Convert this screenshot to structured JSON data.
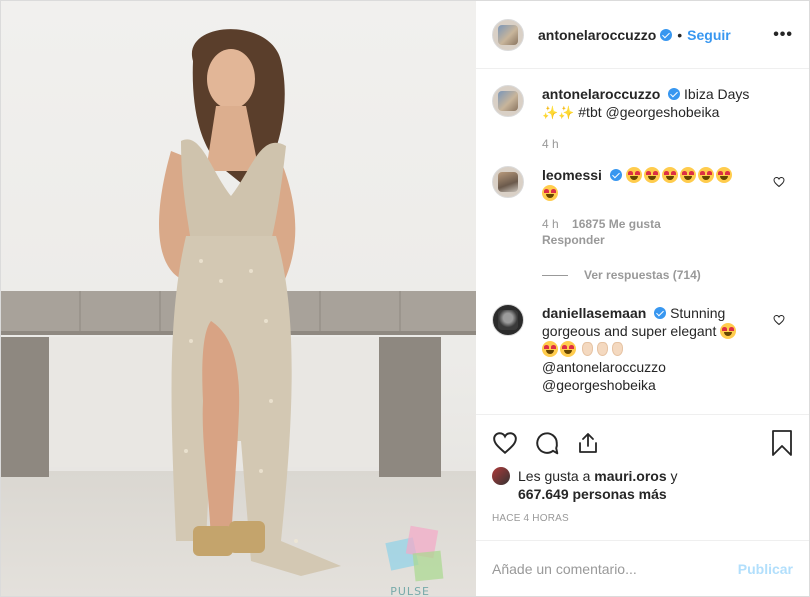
{
  "header": {
    "username": "antonelaroccuzzo",
    "separator": "•",
    "follow_label": "Seguir",
    "more_label": "•••"
  },
  "photo": {
    "watermark_text": "PULSE"
  },
  "caption": {
    "username": "antonelaroccuzzo",
    "text_line1": "Ibiza Days",
    "text_line2": "#tbt @georgeshobeika",
    "time": "4 h"
  },
  "comments": [
    {
      "username": "leomessi",
      "time": "4 h",
      "likes": "16875 Me gusta",
      "reply_label": "Responder",
      "view_replies": "Ver respuestas (714)"
    },
    {
      "username": "daniellasemaan",
      "text_line1": "Stunning",
      "text_line2": "gorgeous and super elegant",
      "mention1": "@antonelaroccuzzo",
      "mention2": "@georgeshobeika"
    }
  ],
  "actions": {
    "icons": [
      "heart-icon",
      "comment-icon",
      "share-icon",
      "bookmark-icon"
    ]
  },
  "likes": {
    "prefix": "Les gusta a",
    "user": "mauri.oros",
    "conj": "y",
    "count": "667.649 personas más"
  },
  "timestamp": "HACE 4 HORAS",
  "add_comment": {
    "placeholder": "Añade un comentario...",
    "publish_label": "Publicar"
  },
  "colors": {
    "accent": "#3897f0",
    "publish_disabled": "#b2dffc",
    "muted": "#999999"
  }
}
